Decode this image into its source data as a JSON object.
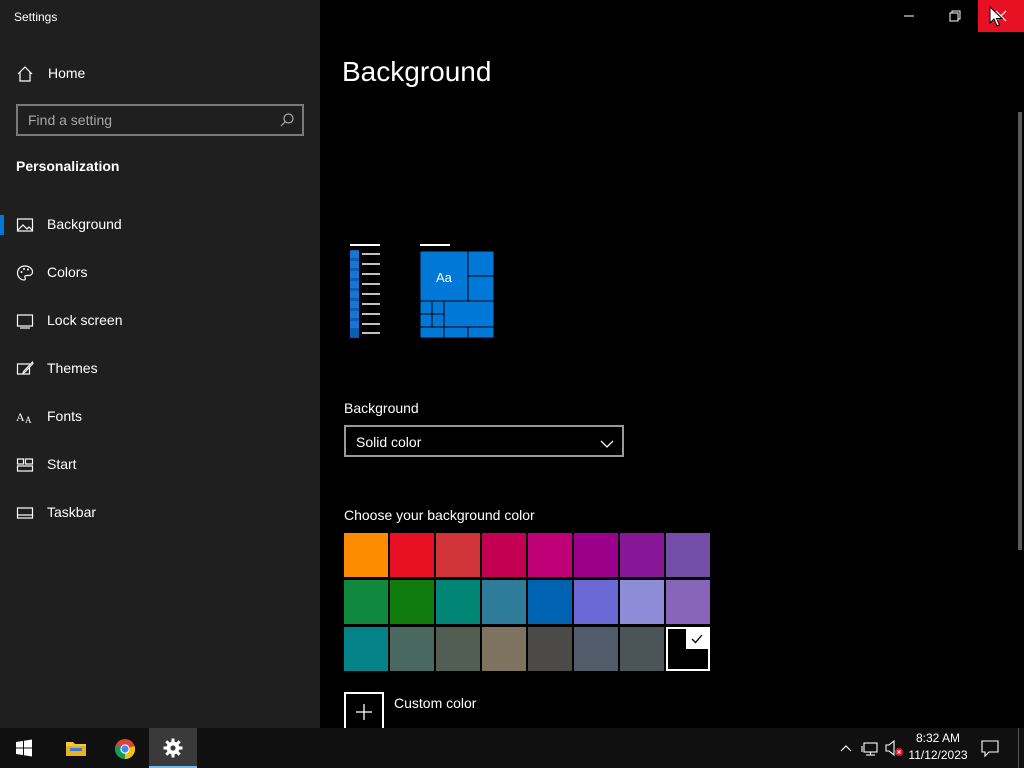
{
  "window": {
    "title": "Settings"
  },
  "sidebar": {
    "home_label": "Home",
    "search_placeholder": "Find a setting",
    "section_title": "Personalization",
    "items": [
      {
        "label": "Background",
        "icon": "picture-icon",
        "selected": true
      },
      {
        "label": "Colors",
        "icon": "palette-icon"
      },
      {
        "label": "Lock screen",
        "icon": "lock-screen-icon"
      },
      {
        "label": "Themes",
        "icon": "brush-icon"
      },
      {
        "label": "Fonts",
        "icon": "fonts-icon"
      },
      {
        "label": "Start",
        "icon": "start-icon"
      },
      {
        "label": "Taskbar",
        "icon": "taskbar-icon"
      }
    ]
  },
  "main": {
    "title": "Background",
    "preview": {
      "sample_text": "Aa"
    },
    "background_label": "Background",
    "background_value": "Solid color",
    "color_label": "Choose your background color",
    "colors": [
      "#ff8c00",
      "#e81123",
      "#d13438",
      "#c30052",
      "#bf0077",
      "#9a0089",
      "#881798",
      "#744da9",
      "#10893e",
      "#107c10",
      "#018574",
      "#2d7d9a",
      "#0063b1",
      "#6b69d6",
      "#8e8cd8",
      "#8764b8",
      "#038387",
      "#486860",
      "#525e54",
      "#7e735f",
      "#4c4a48",
      "#515c6b",
      "#4a5459",
      "#000000"
    ],
    "selected_color": "#000000",
    "custom_color_label": "Custom color"
  },
  "accent_color": "#0078d7",
  "taskbar": {
    "apps": [
      "start-icon",
      "file-explorer-icon",
      "chrome-icon",
      "settings-icon"
    ],
    "time": "8:32 AM",
    "date": "11/12/2023"
  }
}
